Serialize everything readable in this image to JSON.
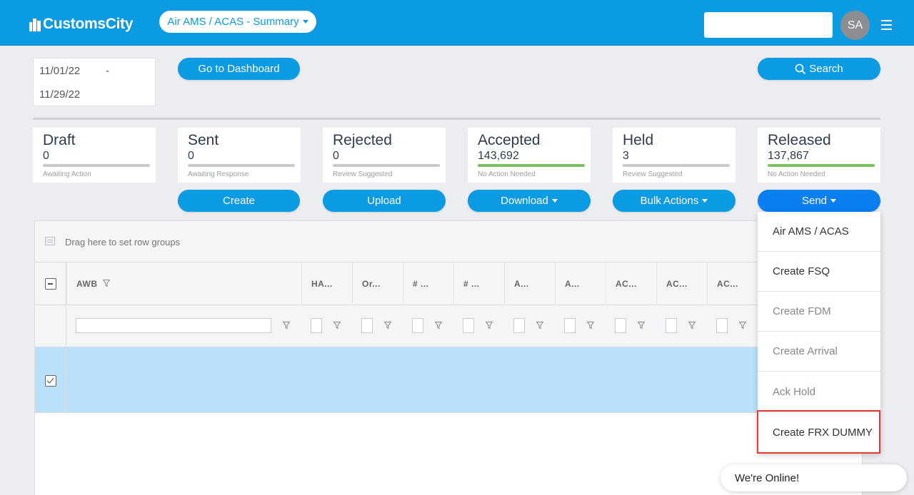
{
  "header": {
    "logo": "CustomsCity",
    "module_select": "Air AMS / ACAS - Summary",
    "search_placeholder": "",
    "avatar_initials": "SA"
  },
  "filters": {
    "date_start": "11/01/22",
    "date_separator": "-",
    "date_end": "11/29/22",
    "dashboard_button": "Go to Dashboard",
    "search_button": "Search"
  },
  "cards": [
    {
      "title": "Draft",
      "count": "0",
      "status": "Awaiting Action",
      "bar_color": "#c7c9cc"
    },
    {
      "title": "Sent",
      "count": "0",
      "status": "Awaiting Response",
      "bar_color": "#c7c9cc"
    },
    {
      "title": "Rejected",
      "count": "0",
      "status": "Review Suggested",
      "bar_color": "#c7c9cc"
    },
    {
      "title": "Accepted",
      "count": "143,692",
      "status": "No Action Needed",
      "bar_color": "#7ac363"
    },
    {
      "title": "Held",
      "count": "3",
      "status": "Review Suggested",
      "bar_color": "#c7c9cc"
    },
    {
      "title": "Released",
      "count": "137,867",
      "status": "No Action Needed",
      "bar_color": "#7ac363"
    }
  ],
  "actions": {
    "create": "Create",
    "upload": "Upload",
    "download": "Download",
    "bulk_actions": "Bulk Actions",
    "send": "Send"
  },
  "grid": {
    "group_hint": "Drag here to set row groups",
    "columns": [
      "AWB",
      "HA...",
      "Or...",
      "# ...",
      "# ...",
      "A...",
      "A...",
      "AC...",
      "AC...",
      "AC..."
    ]
  },
  "send_menu": {
    "items": [
      {
        "label": "Air AMS / ACAS",
        "enabled": true
      },
      {
        "label": "Create FSQ",
        "enabled": true
      },
      {
        "label": "Create FDM",
        "enabled": false
      },
      {
        "label": "Create Arrival",
        "enabled": false
      },
      {
        "label": "Ack Hold",
        "enabled": false
      },
      {
        "label": "Create FRX DUMMY",
        "enabled": true
      }
    ]
  },
  "chat": {
    "status": "We're Online!"
  },
  "colors": {
    "primary": "#0b9be2",
    "send_active": "#0a7ff0",
    "selected_row": "#b9e2fa",
    "highlight": "#e53935"
  }
}
